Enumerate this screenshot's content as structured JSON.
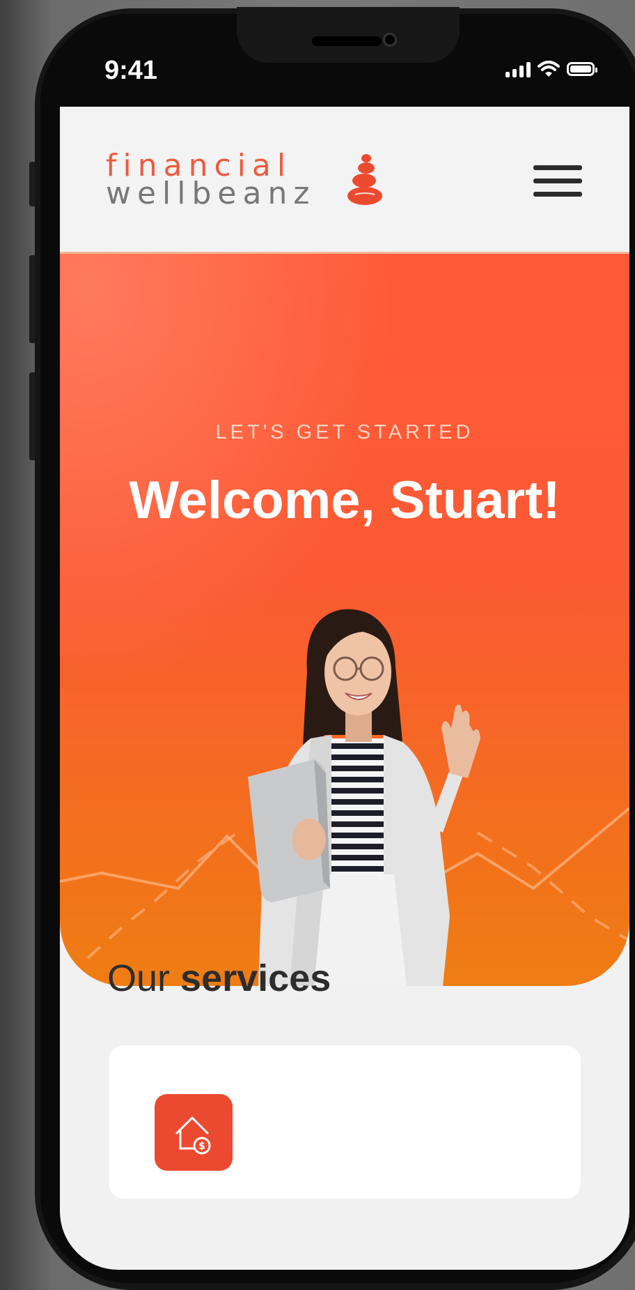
{
  "status_bar": {
    "time": "9:41"
  },
  "brand": {
    "line1": "financial",
    "line2": "wellbeanz"
  },
  "hero": {
    "eyebrow": "LET'S GET STARTED",
    "title": "Welcome, Stuart!"
  },
  "services": {
    "title_light": "Our",
    "title_bold": "services"
  },
  "colors": {
    "accent": "#ec5b3f",
    "hero_top": "#fb5a33",
    "hero_bottom": "#ef7d14"
  },
  "icons": {
    "menu": "hamburger-menu-icon",
    "service": "house-dollar-icon",
    "status": [
      "signal-icon",
      "wifi-icon",
      "battery-icon"
    ]
  }
}
